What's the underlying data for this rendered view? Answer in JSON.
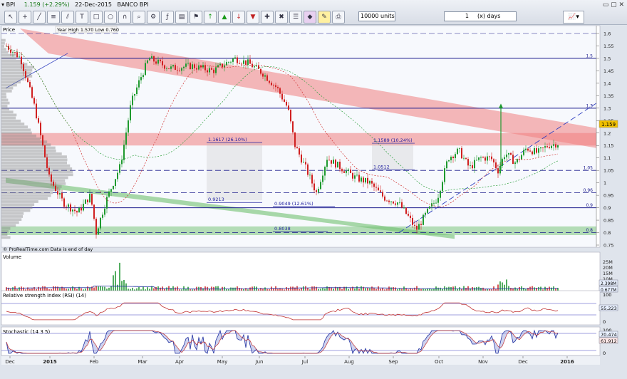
{
  "toolbar": {
    "ticker_label": "BPI",
    "price_change": "1.159 (+2.29%)",
    "date_label": "22-Dec-2015",
    "instrument_name": "BANCO BPI",
    "units_value": "10000 units",
    "period_count": "1",
    "period_unit": "(x) days"
  },
  "price_panel": {
    "title": "Price",
    "year_range": "Year High 1.570 Low 0.760",
    "footer": "© ProRealTime.com  Data is end of day",
    "last_price_tag": "1.159",
    "y_ticks": [
      "1.6",
      "1.55",
      "1.5",
      "1.45",
      "1.4",
      "1.35",
      "1.3",
      "1.25",
      "1.2",
      "1.15",
      "1.1",
      "1.05",
      "1",
      "0.95",
      "0.9",
      "0.85",
      "0.8",
      "0.75"
    ],
    "hline_labels": [
      "1.5",
      "1.3",
      "1.05",
      "0.96",
      "0.9",
      "0.8"
    ],
    "annotations": [
      "1.1617 (26.10%)",
      "1.1589 (10.24%)",
      "1.0512",
      "0.9213",
      "0.9049 (12.61%)",
      "0.8038"
    ]
  },
  "volume_panel": {
    "title": "Volume",
    "y_ticks": [
      "25M",
      "20M",
      "15M",
      "10M",
      "5M"
    ],
    "value_tags": [
      "2.398M",
      "0.677M"
    ]
  },
  "rsi_panel": {
    "title": "Relative strength index (RSI) (14)",
    "y_ticks": [
      "100",
      "0"
    ],
    "value_tag": "55.223"
  },
  "stoch_panel": {
    "title": "Stochastic (14 3 5)",
    "y_ticks": [
      "100",
      "0"
    ],
    "value_tags": [
      "70.474",
      "61.912"
    ]
  },
  "x_axis": {
    "labels": [
      "Dec",
      "2015",
      "Feb",
      "Mar",
      "Apr",
      "May",
      "Jun",
      "Jul",
      "Aug",
      "Sep",
      "Oct",
      "Nov",
      "Dec",
      "2016"
    ]
  },
  "chart_data": {
    "type": "line",
    "title": "BANCO BPI",
    "x_labels": [
      "Dec",
      "2015",
      "Feb",
      "Mar",
      "Apr",
      "May",
      "Jun",
      "Jul",
      "Aug",
      "Sep",
      "Oct",
      "Nov",
      "Dec"
    ],
    "series": [
      {
        "name": "BPI",
        "values": [
          1.55,
          1.0,
          0.86,
          1.46,
          1.46,
          1.5,
          1.4,
          1.15,
          1.02,
          0.85,
          1.1,
          1.07,
          1.159
        ]
      }
    ],
    "ylim": [
      0.75,
      1.62
    ],
    "horizontal_levels": [
      1.5,
      1.3,
      1.05,
      0.96,
      0.9,
      0.8
    ],
    "colors": {
      "up": "#1f9a2f",
      "down": "#d02020",
      "resistance_band": "#f08080",
      "support_band": "#6fbf6f",
      "level": "#1a1a8c"
    }
  }
}
